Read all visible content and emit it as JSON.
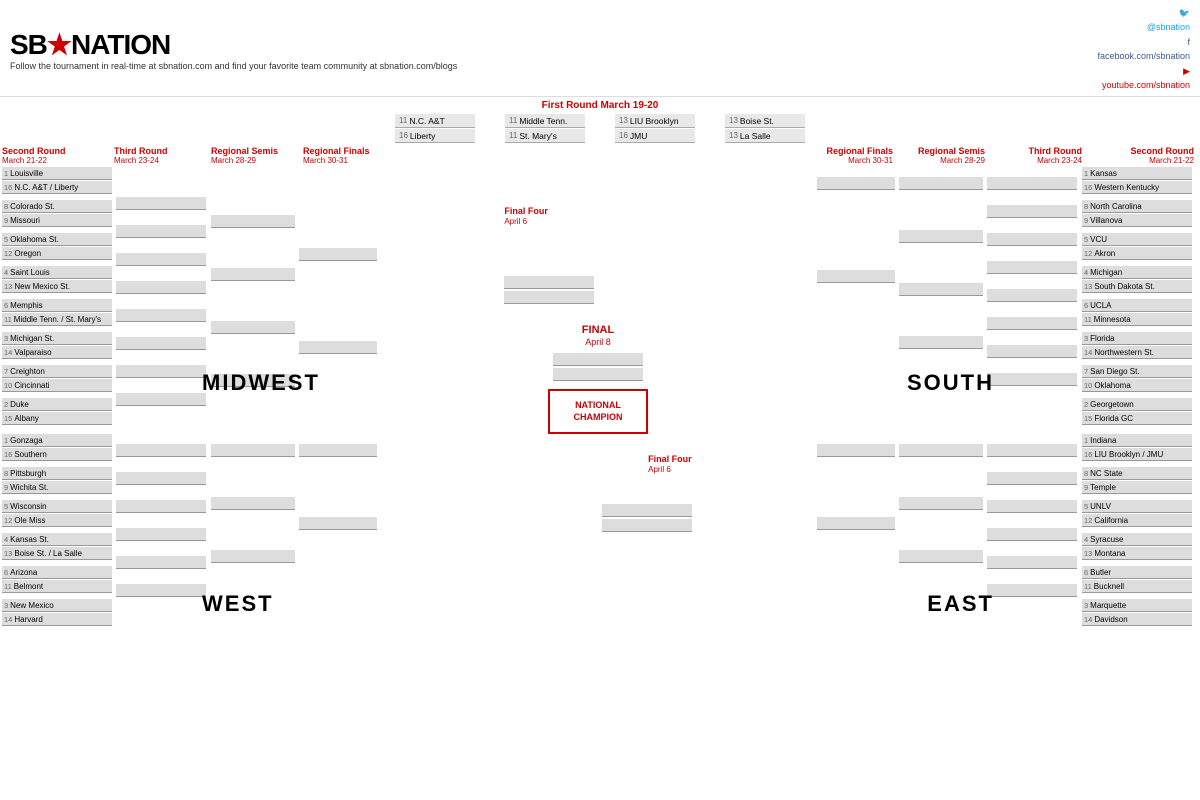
{
  "header": {
    "logo": "SB★NATION",
    "tagline": "Follow the tournament in real-time at sbnation.com and find your favorite team community at sbnation.com/blogs",
    "social": {
      "twitter": "@sbnation",
      "twitter_url": "twitter.com/sbnation",
      "facebook": "facebook.com/sbnation",
      "youtube": "youtube.com/sbnation"
    }
  },
  "rounds": {
    "first_round": "First Round",
    "first_round_dates": "March 19-20",
    "second_round": "Second Round",
    "second_round_dates": "March 21-22",
    "third_round": "Third Round",
    "third_round_dates": "March 23-24",
    "regional_semis": "Regional Semis",
    "regional_semis_dates": "March 28-29",
    "regional_finals": "Regional Finals",
    "regional_finals_dates": "March 30-31",
    "final_four": "Final Four",
    "final_four_date": "April 6",
    "final": "FINAL",
    "final_date": "April 8",
    "national_champion": "NATIONAL CHAMPION"
  },
  "regions": {
    "midwest": "MIDWEST",
    "west": "WEST",
    "south": "SOUTH",
    "east": "EAST"
  },
  "midwest_teams": [
    {
      "seed": "1",
      "name": "Louisville"
    },
    {
      "seed": "16",
      "name": "N.C. A&T / Liberty"
    },
    {
      "seed": "8",
      "name": "Colorado St."
    },
    {
      "seed": "9",
      "name": "Missouri"
    },
    {
      "seed": "5",
      "name": "Oklahoma St."
    },
    {
      "seed": "12",
      "name": "Oregon"
    },
    {
      "seed": "4",
      "name": "Saint Louis"
    },
    {
      "seed": "13",
      "name": "New Mexico St."
    },
    {
      "seed": "6",
      "name": "Memphis"
    },
    {
      "seed": "11",
      "name": "Middle Tenn. / St. Mary's"
    },
    {
      "seed": "3",
      "name": "Michigan St."
    },
    {
      "seed": "14",
      "name": "Valparaiso"
    },
    {
      "seed": "7",
      "name": "Creighton"
    },
    {
      "seed": "10",
      "name": "Cincinnati"
    },
    {
      "seed": "2",
      "name": "Duke"
    },
    {
      "seed": "15",
      "name": "Albany"
    }
  ],
  "west_teams": [
    {
      "seed": "1",
      "name": "Gonzaga"
    },
    {
      "seed": "16",
      "name": "Southern"
    },
    {
      "seed": "8",
      "name": "Pittsburgh"
    },
    {
      "seed": "9",
      "name": "Wichita St."
    },
    {
      "seed": "5",
      "name": "Wisconsin"
    },
    {
      "seed": "12",
      "name": "Ole Miss"
    },
    {
      "seed": "4",
      "name": "Kansas St."
    },
    {
      "seed": "13",
      "name": "Boise St. / La Salle"
    },
    {
      "seed": "6",
      "name": "Arizona"
    },
    {
      "seed": "11",
      "name": "Belmont"
    },
    {
      "seed": "3",
      "name": "New Mexico"
    },
    {
      "seed": "14",
      "name": "Harvard"
    }
  ],
  "south_teams": [
    {
      "seed": "1",
      "name": "Kansas"
    },
    {
      "seed": "16",
      "name": "Western Kentucky"
    },
    {
      "seed": "8",
      "name": "North Carolina"
    },
    {
      "seed": "9",
      "name": "Villanova"
    },
    {
      "seed": "5",
      "name": "VCU"
    },
    {
      "seed": "12",
      "name": "Akron"
    },
    {
      "seed": "4",
      "name": "Michigan"
    },
    {
      "seed": "13",
      "name": "South Dakota St."
    },
    {
      "seed": "6",
      "name": "UCLA"
    },
    {
      "seed": "11",
      "name": "Minnesota"
    },
    {
      "seed": "3",
      "name": "Florida"
    },
    {
      "seed": "14",
      "name": "Northwestern St."
    },
    {
      "seed": "7",
      "name": "San Diego St."
    },
    {
      "seed": "10",
      "name": "Oklahoma"
    },
    {
      "seed": "2",
      "name": "Georgetown"
    },
    {
      "seed": "15",
      "name": "Florida GC"
    }
  ],
  "east_teams": [
    {
      "seed": "1",
      "name": "Indiana"
    },
    {
      "seed": "16",
      "name": "LIU Brooklyn / JMU"
    },
    {
      "seed": "8",
      "name": "NC State"
    },
    {
      "seed": "9",
      "name": "Temple"
    },
    {
      "seed": "5",
      "name": "UNLV"
    },
    {
      "seed": "12",
      "name": "California"
    },
    {
      "seed": "4",
      "name": "Syracuse"
    },
    {
      "seed": "13",
      "name": "Montana"
    },
    {
      "seed": "6",
      "name": "Butler"
    },
    {
      "seed": "11",
      "name": "Bucknell"
    },
    {
      "seed": "3",
      "name": "Marquette"
    },
    {
      "seed": "14",
      "name": "Davidson"
    }
  ],
  "playin": {
    "top_left_1": {
      "seed": "11",
      "name": "N.C. A&T"
    },
    "top_left_2": {
      "seed": "16",
      "name": "Liberty"
    },
    "top_right_1": {
      "seed": "11",
      "name": "Middle Tenn."
    },
    "top_right_2": {
      "seed": "11",
      "name": "St. Mary's"
    },
    "top_right3_1": {
      "seed": "13",
      "name": "LIU Brooklyn"
    },
    "top_right3_2": {
      "seed": "16",
      "name": "JMU"
    },
    "top_right4_1": {
      "seed": "13",
      "name": "Boise St."
    },
    "top_right4_2": {
      "seed": "13",
      "name": "La Salle"
    }
  }
}
